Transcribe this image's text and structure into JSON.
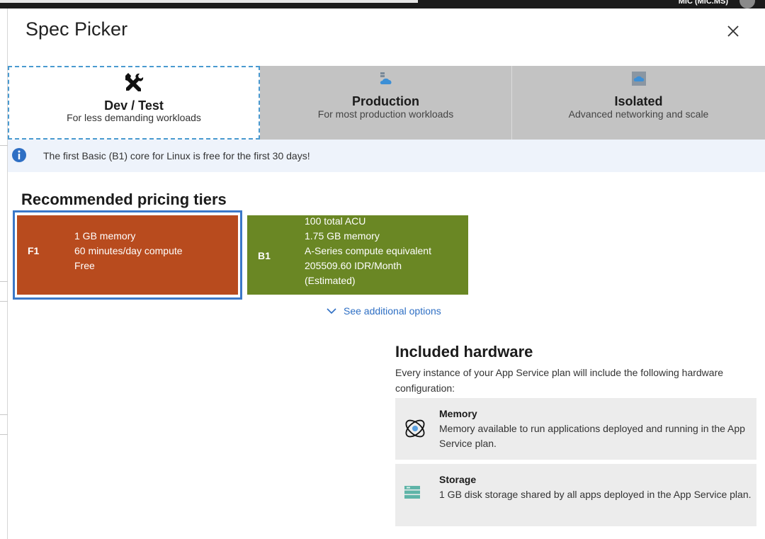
{
  "window": {
    "user": "MIC (MIC.MS)"
  },
  "title": "Spec Picker",
  "tabs": [
    {
      "title": "Dev / Test",
      "subtitle": "For less demanding workloads",
      "icon": "tools-icon",
      "selected": true
    },
    {
      "title": "Production",
      "subtitle": "For most production workloads",
      "icon": "production-icon",
      "selected": false
    },
    {
      "title": "Isolated",
      "subtitle": "Advanced networking and scale",
      "icon": "isolated-icon",
      "selected": false
    }
  ],
  "info": {
    "text": "The first Basic (B1) core for Linux is free for the first 30 days!"
  },
  "recommended": {
    "title": "Recommended pricing tiers",
    "tiers": [
      {
        "code": "F1",
        "lines": [
          "1 GB memory",
          "60 minutes/day compute",
          "Free"
        ],
        "color": "#b84b1e",
        "selected": true
      },
      {
        "code": "B1",
        "lines": [
          "100 total ACU",
          "1.75 GB memory",
          "A-Series compute equivalent",
          "205509.60 IDR/Month",
          "(Estimated)"
        ],
        "color": "#6a8724",
        "selected": false
      }
    ],
    "see_more": "See additional options"
  },
  "hardware": {
    "title": "Included hardware",
    "description": "Every instance of your App Service plan will include the following hardware configuration:",
    "items": [
      {
        "name": "Memory",
        "text": "Memory available to run applications deployed and running in the App Service plan.",
        "icon": "memory-icon"
      },
      {
        "name": "Storage",
        "text": "1 GB disk storage shared by all apps deployed in the App Service plan.",
        "icon": "storage-icon"
      }
    ]
  },
  "colors": {
    "accent": "#2e6fc4",
    "selected_border": "#3b78c8",
    "tab_background": "#c3c3c3",
    "info_background": "#eef3fb"
  }
}
